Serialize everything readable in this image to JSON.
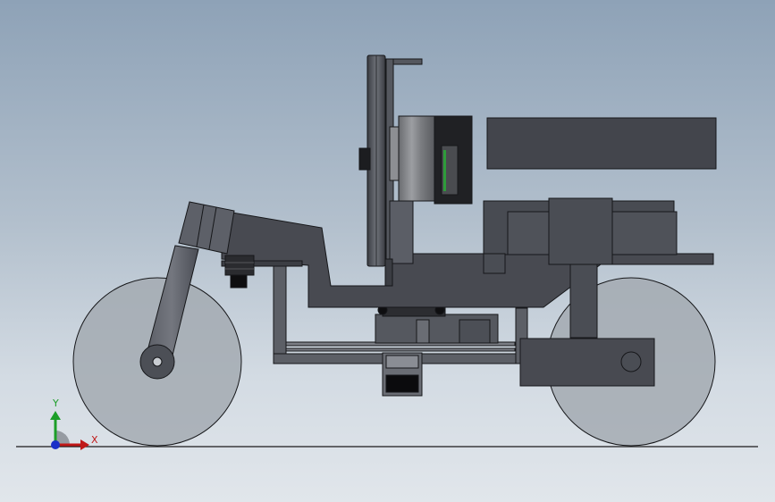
{
  "triad": {
    "y_label": "Y",
    "x_label": "X",
    "colors": {
      "y_axis": "#1c9e28",
      "x_axis": "#c01818",
      "z_axis": "#1a2fc8"
    }
  },
  "colors": {
    "part_dark": "#43454c",
    "part_mid": "#4e5158",
    "part_light": "#5b5e66",
    "edge": "#16171a",
    "wheel_fill": "#9fa6ae",
    "ground_line": "#1a1a1a",
    "wire_accent": "#2e9c3a"
  }
}
